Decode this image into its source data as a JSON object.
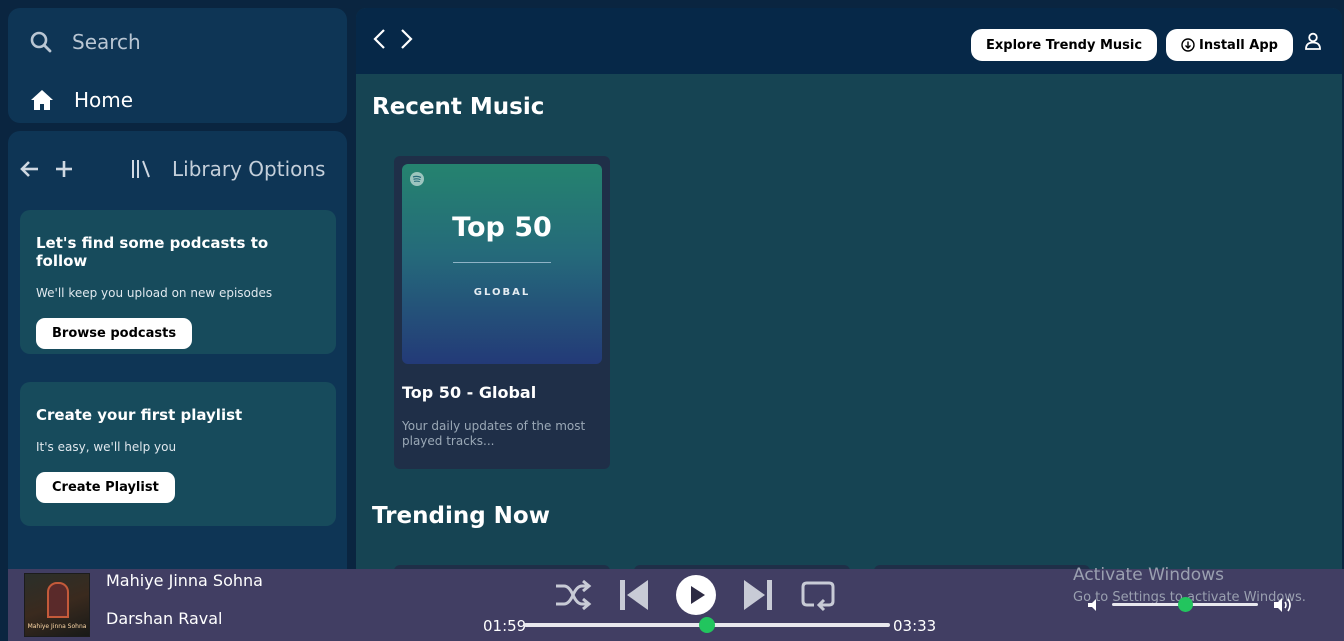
{
  "sidebar": {
    "search_label": "Search",
    "home_label": "Home",
    "library_label": "Library Options",
    "promos": [
      {
        "title": "Let's find some podcasts to follow",
        "text": "We'll keep you upload on new episodes",
        "button": "Browse podcasts"
      },
      {
        "title": "Create your first playlist",
        "text": "It's easy, we'll help you",
        "button": "Create Playlist"
      }
    ]
  },
  "topbar": {
    "explore_label": "Explore Trendy Music",
    "install_label": "Install App"
  },
  "main": {
    "recent_title": "Recent Music",
    "trending_title": "Trending Now",
    "cards": [
      {
        "cover_big": "Top 50",
        "cover_small": "GLOBAL",
        "title": "Top 50 - Global",
        "desc": "Your daily updates of the most played tracks..."
      }
    ]
  },
  "player": {
    "song": "Mahiye Jinna Sohna",
    "artist": "Darshan Raval",
    "album_caption": "Mahiye Jinna Sohna",
    "elapsed": "01:59",
    "duration": "03:33",
    "progress": 0.5,
    "volume": 0.5,
    "accent": "#22c55e"
  },
  "watermark": {
    "line1": "Activate Windows",
    "line2": "Go to Settings to activate Windows."
  }
}
